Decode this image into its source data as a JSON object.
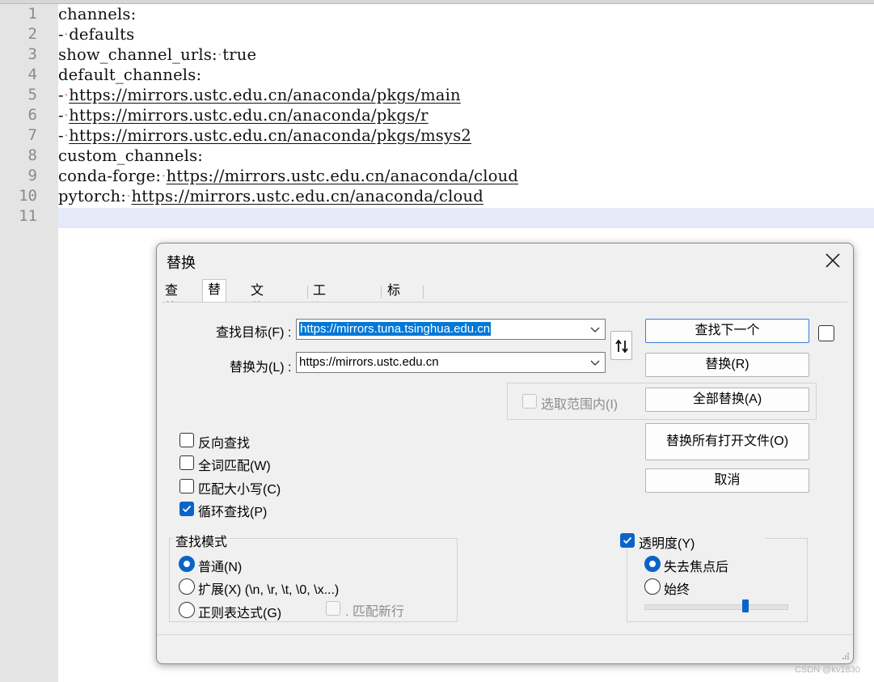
{
  "editor": {
    "lines": [
      {
        "no": "1",
        "parts": [
          {
            "t": "channels:"
          }
        ]
      },
      {
        "no": "2",
        "parts": [
          {
            "t": "-"
          },
          {
            "ws": "·"
          },
          {
            "t": "defaults"
          }
        ]
      },
      {
        "no": "3",
        "parts": [
          {
            "t": "show_channel_urls:"
          },
          {
            "ws": "·"
          },
          {
            "t": "true"
          }
        ]
      },
      {
        "no": "4",
        "parts": [
          {
            "t": "default_channels:"
          }
        ]
      },
      {
        "no": "5",
        "parts": [
          {
            "t": "-"
          },
          {
            "ws": "·"
          },
          {
            "url": "https://mirrors.ustc.edu.cn/anaconda/pkgs/main"
          }
        ]
      },
      {
        "no": "6",
        "parts": [
          {
            "t": "-"
          },
          {
            "ws": "·"
          },
          {
            "url": "https://mirrors.ustc.edu.cn/anaconda/pkgs/r"
          }
        ]
      },
      {
        "no": "7",
        "parts": [
          {
            "t": "-"
          },
          {
            "ws": "·"
          },
          {
            "url": "https://mirrors.ustc.edu.cn/anaconda/pkgs/msys2"
          }
        ]
      },
      {
        "no": "8",
        "parts": [
          {
            "t": "custom_channels:"
          }
        ]
      },
      {
        "no": "9",
        "parts": [
          {
            "t": "conda-forge:"
          },
          {
            "ws": "·"
          },
          {
            "url": "https://mirrors.ustc.edu.cn/anaconda/cloud"
          }
        ]
      },
      {
        "no": "10",
        "parts": [
          {
            "t": "pytorch:"
          },
          {
            "ws": "·"
          },
          {
            "url": "https://mirrors.ustc.edu.cn/anaconda/cloud"
          }
        ]
      },
      {
        "no": "11",
        "parts": []
      }
    ],
    "whitespace_color": "#e59c7a",
    "current_line_color": "#e6e9f8"
  },
  "dialog": {
    "title": "替换",
    "tabs": [
      {
        "label": "查找",
        "active": false
      },
      {
        "label": "替换",
        "active": true
      },
      {
        "label": "文件查找",
        "active": false
      },
      {
        "label": "工程中查找",
        "active": false
      },
      {
        "label": "标记",
        "active": false
      }
    ],
    "find_label": "查找目标(F) :",
    "find_value": "https://mirrors.tuna.tsinghua.edu.cn",
    "replace_label": "替换为(L) :",
    "replace_value": "https://mirrors.ustc.edu.cn",
    "swap_icon": "swap-arrows-icon",
    "buttons": {
      "find_next": "查找下一个",
      "replace": "替换(R)",
      "replace_all": "全部替换(A)",
      "replace_all_open": "替换所有打开文件(O)",
      "cancel": "取消"
    },
    "in_selection": {
      "label": "选取范围内(I)",
      "checked": false,
      "enabled": false
    },
    "options": [
      {
        "label": "反向查找",
        "checked": false
      },
      {
        "label": "全词匹配(W)",
        "checked": false
      },
      {
        "label": "匹配大小写(C)",
        "checked": false
      },
      {
        "label": "循环查找(P)",
        "checked": true
      }
    ],
    "search_mode": {
      "title": "查找模式",
      "modes": [
        {
          "label": "普通(N)",
          "selected": true
        },
        {
          "label": "扩展(X) (\\n, \\r, \\t, \\0, \\x...)",
          "selected": false
        },
        {
          "label": "正则表达式(G)",
          "selected": false
        }
      ],
      "dot_newline": {
        "label": ". 匹配新行",
        "checked": false,
        "enabled": false
      }
    },
    "transparency": {
      "label": "透明度(Y)",
      "checked": true,
      "modes": [
        {
          "label": "失去焦点后",
          "selected": true
        },
        {
          "label": "始终",
          "selected": false
        }
      ],
      "level": 0.71
    },
    "accent_color": "#0a64c8"
  },
  "watermark": "CSDN @kv1830"
}
